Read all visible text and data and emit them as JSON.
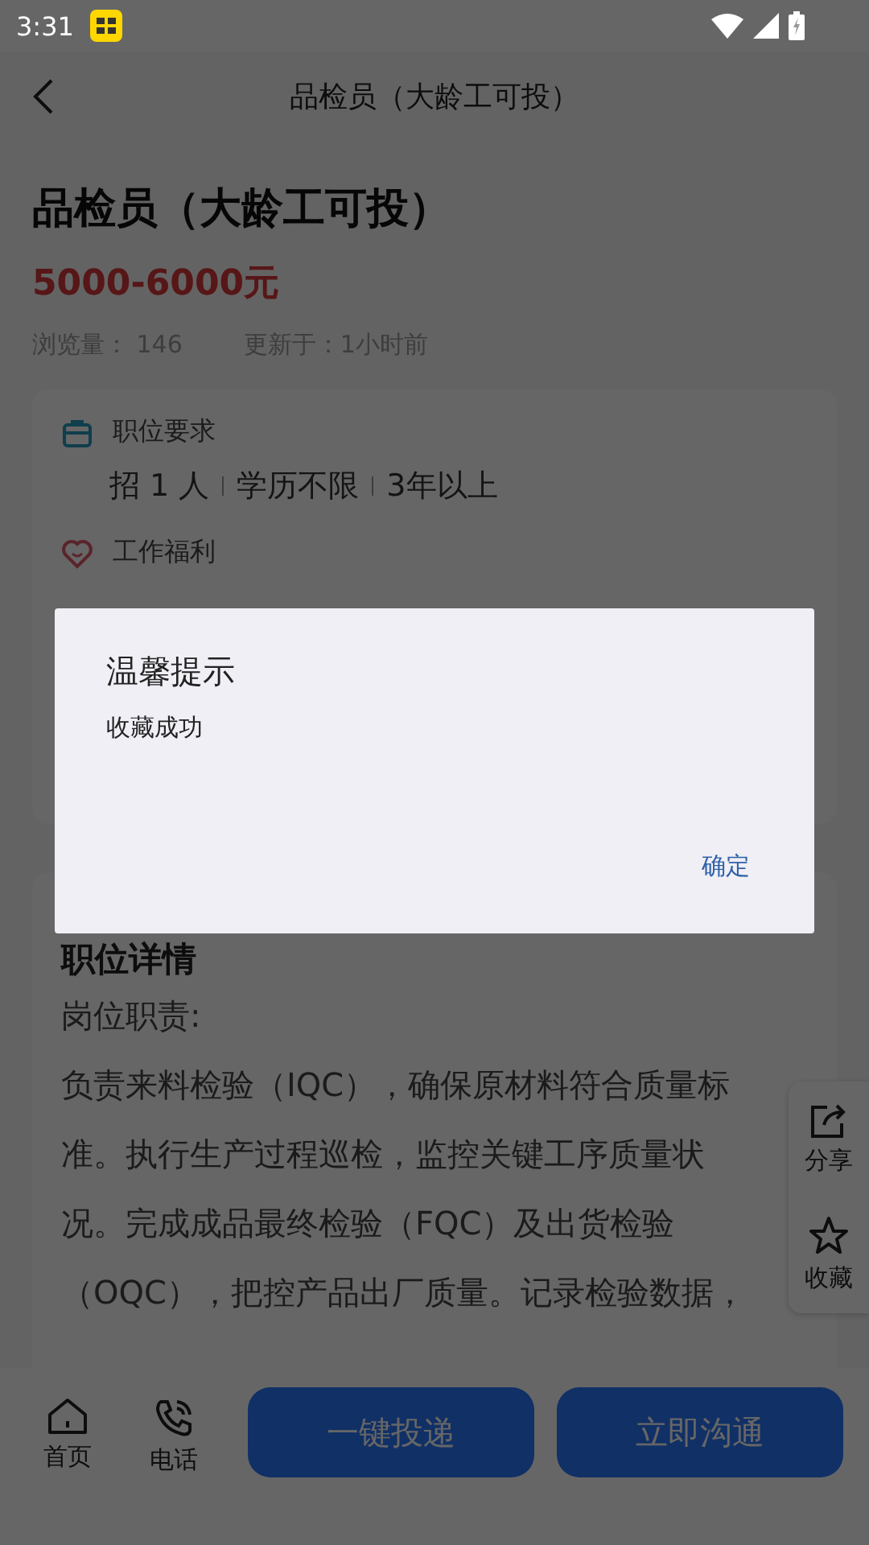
{
  "status_bar": {
    "time": "3:31"
  },
  "header": {
    "title": "品检员（大龄工可投）"
  },
  "job": {
    "title": "品检员（大龄工可投）",
    "salary": "5000-6000元",
    "views_label": "浏览量：",
    "views": "146",
    "updated": "更新于：1小时前"
  },
  "requirements": {
    "heading": "职位要求",
    "tags": [
      "招 1 人",
      "学历不限",
      "3年以上"
    ]
  },
  "benefits": {
    "heading": "工作福利"
  },
  "details": {
    "heading": "职位详情",
    "paragraphs": [
      "岗位职责:",
      "负责来料检验（IQC），确保原材料符合质量标准。执行生产过程巡检，监控关键工序质量状况。完成成品最终检验（FQC）及出货检验（OQC），把控产品出厂质量。记录检验数据，"
    ]
  },
  "side_actions": [
    {
      "kind": "share",
      "label": "分享"
    },
    {
      "kind": "favorite",
      "label": "收藏"
    }
  ],
  "bottom_bar": {
    "nav": [
      {
        "kind": "home",
        "label": "首页"
      },
      {
        "kind": "phone",
        "label": "电话"
      }
    ],
    "buttons": [
      "一键投递",
      "立即沟通"
    ]
  },
  "dialog": {
    "title": "温馨提示",
    "message": "收藏成功",
    "confirm": "确定"
  }
}
